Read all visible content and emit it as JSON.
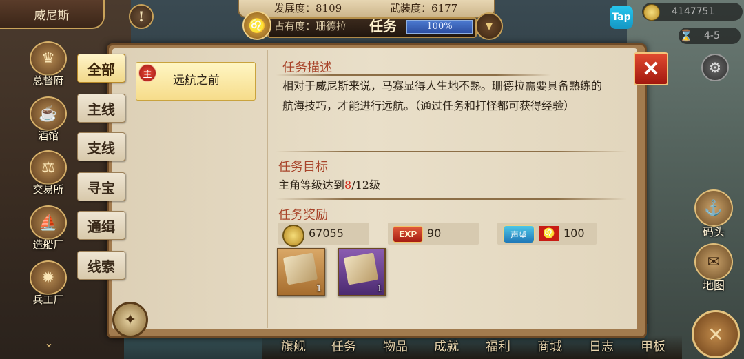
{
  "top_bar": {
    "city": "威尼斯",
    "alert_icon": "exclamation-icon",
    "development_label": "发展度：",
    "development_value": "8109",
    "armament_label": "武装度：",
    "armament_value": "6177",
    "occupancy_text": "占有度：珊德拉",
    "panel_title": "任务",
    "occupancy_percent": "100%",
    "occupancy_fraction": 1.0,
    "tap_label": "Tap",
    "gold": "4147751",
    "level_range": "4-5"
  },
  "left_nav": [
    {
      "label": "总督府",
      "icon": "crown-icon"
    },
    {
      "label": "酒馆",
      "icon": "chef-hat-icon"
    },
    {
      "label": "交易所",
      "icon": "scales-icon"
    },
    {
      "label": "造船厂",
      "icon": "ship-icon"
    },
    {
      "label": "兵工厂",
      "icon": "cannon-icon"
    }
  ],
  "right_nav": [
    {
      "label": "码头",
      "icon": "dock-icon"
    },
    {
      "label": "地图",
      "icon": "map-scroll-icon"
    }
  ],
  "bottom_nav": [
    "旗舰",
    "任务",
    "物品",
    "成就",
    "福利",
    "商城",
    "日志",
    "甲板"
  ],
  "tabs": [
    "全部",
    "主线",
    "支线",
    "寻宝",
    "通缉",
    "线索"
  ],
  "active_tab": "全部",
  "quest_list": [
    {
      "badge": "主",
      "name": "远航之前",
      "selected": true
    }
  ],
  "detail": {
    "desc_title": "任务描述",
    "desc_body": "相对于威尼斯来说，马赛显得人生地不熟。珊德拉需要具备熟练的航海技巧，才能进行远航。（通过任务和打怪都可获得经验）",
    "objective_title": "任务目标",
    "objective_prefix": "主角等级达到",
    "objective_current": "8",
    "objective_suffix": "/12级",
    "reward_title": "任务奖励",
    "rewards": {
      "gold": "67055",
      "exp_label": "EXP",
      "exp": "90",
      "reputation_label": "声望",
      "reputation": "100"
    },
    "items": [
      {
        "icon": "letter-quill-icon",
        "count": "1",
        "rarity_color": "#c8934a"
      },
      {
        "icon": "blueprint-scroll-icon",
        "count": "1",
        "rarity_color": "#6a3d8e"
      }
    ]
  }
}
